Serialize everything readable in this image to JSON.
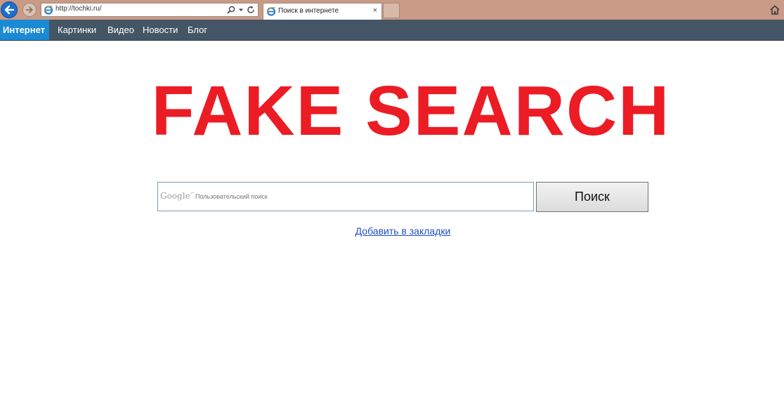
{
  "browser": {
    "address_url": "http://tochki.ru/",
    "tab_title": "Поиск в интернете",
    "tab_close": "×",
    "icons": {
      "back": "back-arrow-icon",
      "forward": "forward-arrow-icon",
      "site": "ie-logo-icon",
      "search": "search-icon",
      "dropdown": "chevron-down-icon",
      "refresh": "refresh-icon",
      "home": "home-icon"
    },
    "colors": {
      "frame": "#c99a86",
      "back_button": "#1e6fcc"
    }
  },
  "site_nav": {
    "items": [
      {
        "label": "Интернет",
        "active": true
      },
      {
        "label": "Картинки",
        "active": false
      },
      {
        "label": "Видео",
        "active": false
      },
      {
        "label": "Новости",
        "active": false
      },
      {
        "label": "Блог",
        "active": false
      }
    ],
    "colors": {
      "bar": "#445566",
      "active": "#1a8ad4"
    }
  },
  "main": {
    "headline": "FAKE SEARCH",
    "headline_color": "#ec1c24",
    "search": {
      "google_label": "Google",
      "google_tm": "™",
      "placeholder": "Пользовательский поиск",
      "button_label": "Поиск"
    },
    "bookmark_link": "Добавить в закладки"
  }
}
